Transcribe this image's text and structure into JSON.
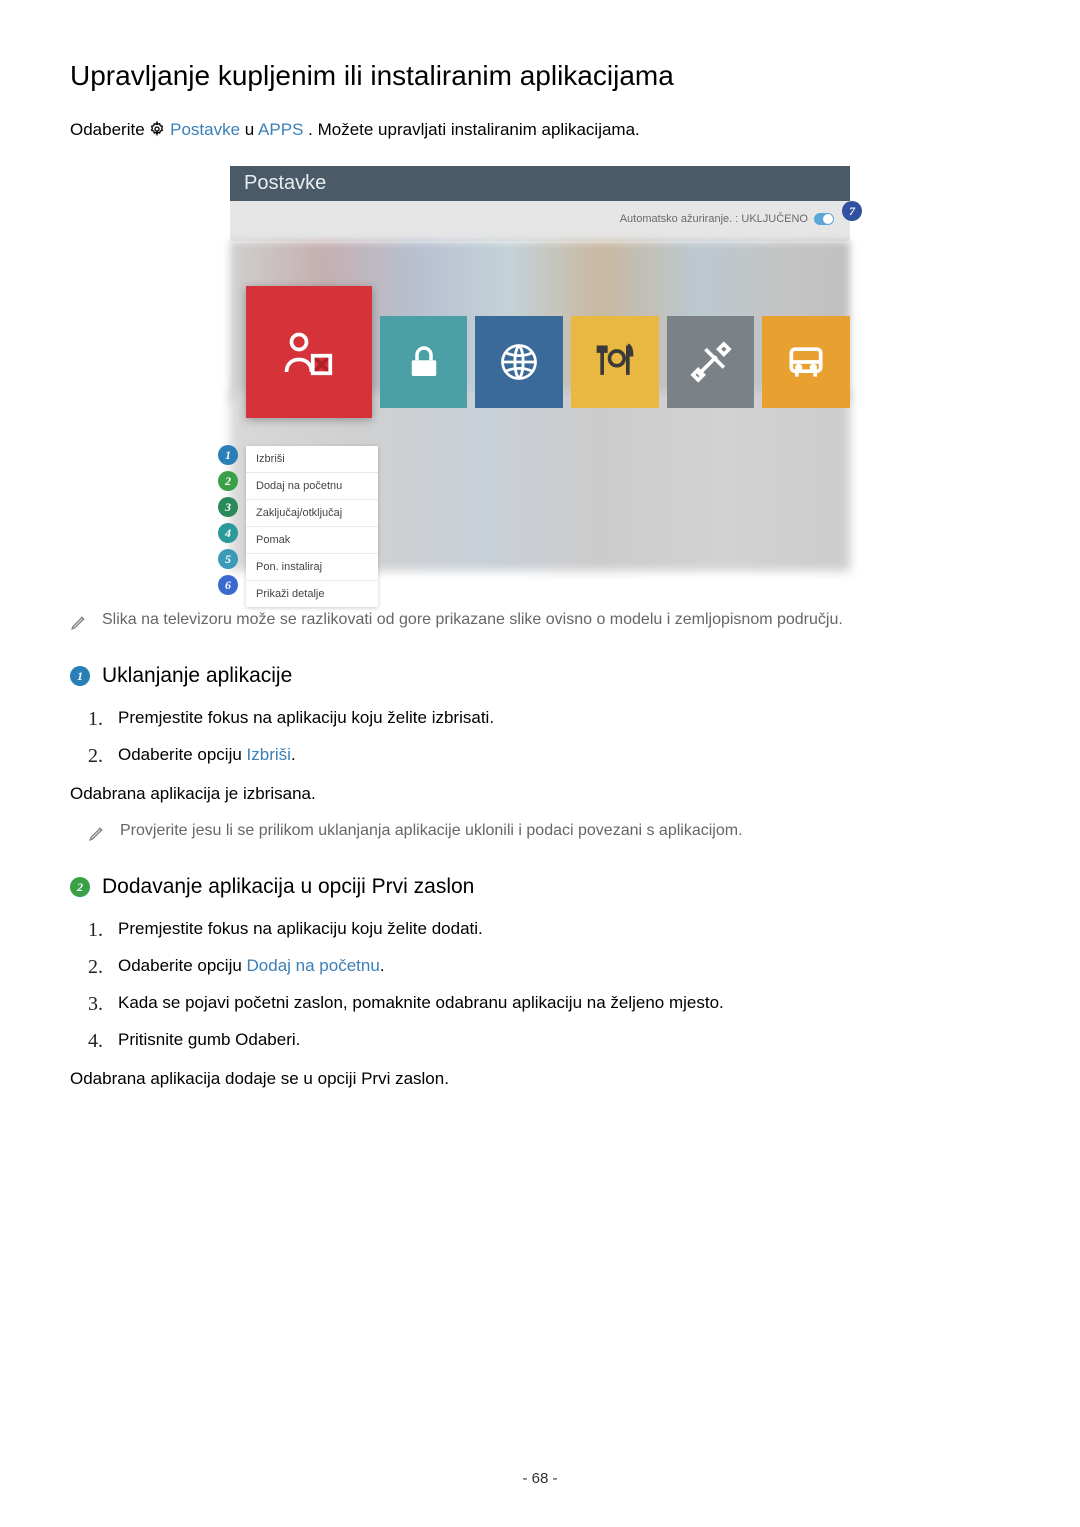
{
  "title": "Upravljanje kupljenim ili instaliranim aplikacijama",
  "intro_pre": "Odaberite ",
  "intro_postavke": "Postavke",
  "intro_mid": " u ",
  "intro_apps": "APPS",
  "intro_post": ". Možete upravljati instaliranim aplikacijama.",
  "ss_title": "Postavke",
  "auto_update": "Automatsko ažuriranje. : UKLJUČENO",
  "ctx_items": {
    "i1": "Izbriši",
    "i2": "Dodaj na početnu",
    "i3": "Zaključaj/otključaj",
    "i4": "Pomak",
    "i5": "Pon. instaliraj",
    "i6": "Prikaži detalje"
  },
  "callout_nums": {
    "n1": "1",
    "n2": "2",
    "n3": "3",
    "n4": "4",
    "n5": "5",
    "n6": "6",
    "n7": "7"
  },
  "note1": "Slika na televizoru može se razlikovati od gore prikazane slike ovisno o modelu i zemljopisnom području.",
  "section1": {
    "badge": "1",
    "title": "Uklanjanje aplikacije",
    "step1": "Premjestite fokus na aplikaciju koju želite izbrisati.",
    "step2_pre": "Odaberite opciju ",
    "step2_link": "Izbriši",
    "step2_post": ".",
    "result": "Odabrana aplikacija je izbrisana.",
    "note": "Provjerite jesu li se prilikom uklanjanja aplikacije uklonili i podaci povezani s aplikacijom."
  },
  "section2": {
    "badge": "2",
    "title": "Dodavanje aplikacija u opciji Prvi zaslon",
    "step1": "Premjestite fokus na aplikaciju koju želite dodati.",
    "step2_pre": "Odaberite opciju ",
    "step2_link": "Dodaj na početnu",
    "step2_post": ".",
    "step3": "Kada se pojavi početni zaslon, pomaknite odabranu aplikaciju na željeno mjesto.",
    "step4": "Pritisnite gumb Odaberi.",
    "result": "Odabrana aplikacija dodaje se u opciji Prvi zaslon."
  },
  "page_num": "- 68 -"
}
